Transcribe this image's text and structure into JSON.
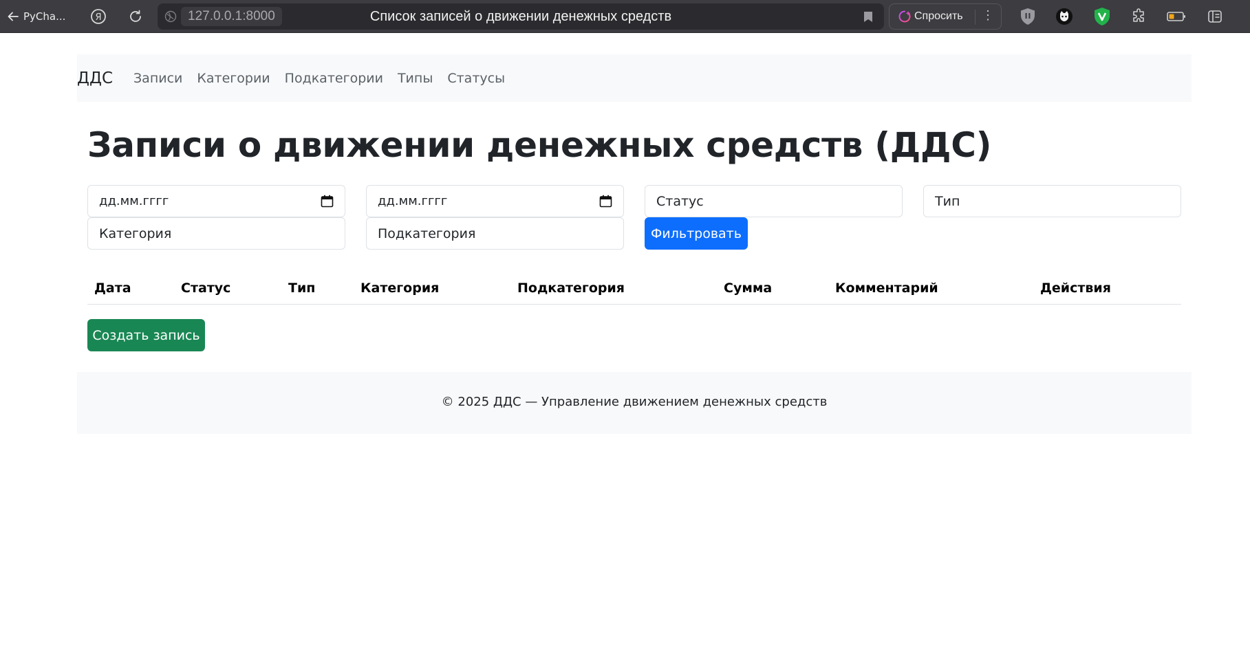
{
  "browser": {
    "back_label": "PyCha...",
    "url": "127.0.0.1:8000",
    "tab_title": "Список записей о движении денежных средств",
    "ask_label": "Спросить",
    "ask_more": "⋮"
  },
  "navbar": {
    "brand": "ДДС",
    "links": [
      "Записи",
      "Категории",
      "Подкатегории",
      "Типы",
      "Статусы"
    ]
  },
  "page": {
    "title": "Записи о движении денежных средств (ДДС)"
  },
  "filters": {
    "date_from_placeholder": "дд.мм.гггг",
    "date_to_placeholder": "дд.мм.гггг",
    "status_placeholder": "Статус",
    "type_placeholder": "Тип",
    "category_placeholder": "Категория",
    "subcategory_placeholder": "Подкатегория",
    "submit_label": "Фильтровать"
  },
  "table": {
    "columns": [
      "Дата",
      "Статус",
      "Тип",
      "Категория",
      "Подкатегория",
      "Сумма",
      "Комментарий",
      "Действия"
    ],
    "rows": []
  },
  "actions": {
    "create_label": "Создать запись"
  },
  "footer": {
    "text": "© 2025 ДДС — Управление движением денежных средств"
  },
  "colors": {
    "primary": "#0d6efd",
    "success": "#198754",
    "light_bg": "#f8f9fa",
    "chrome_bg": "#3c3c41"
  }
}
